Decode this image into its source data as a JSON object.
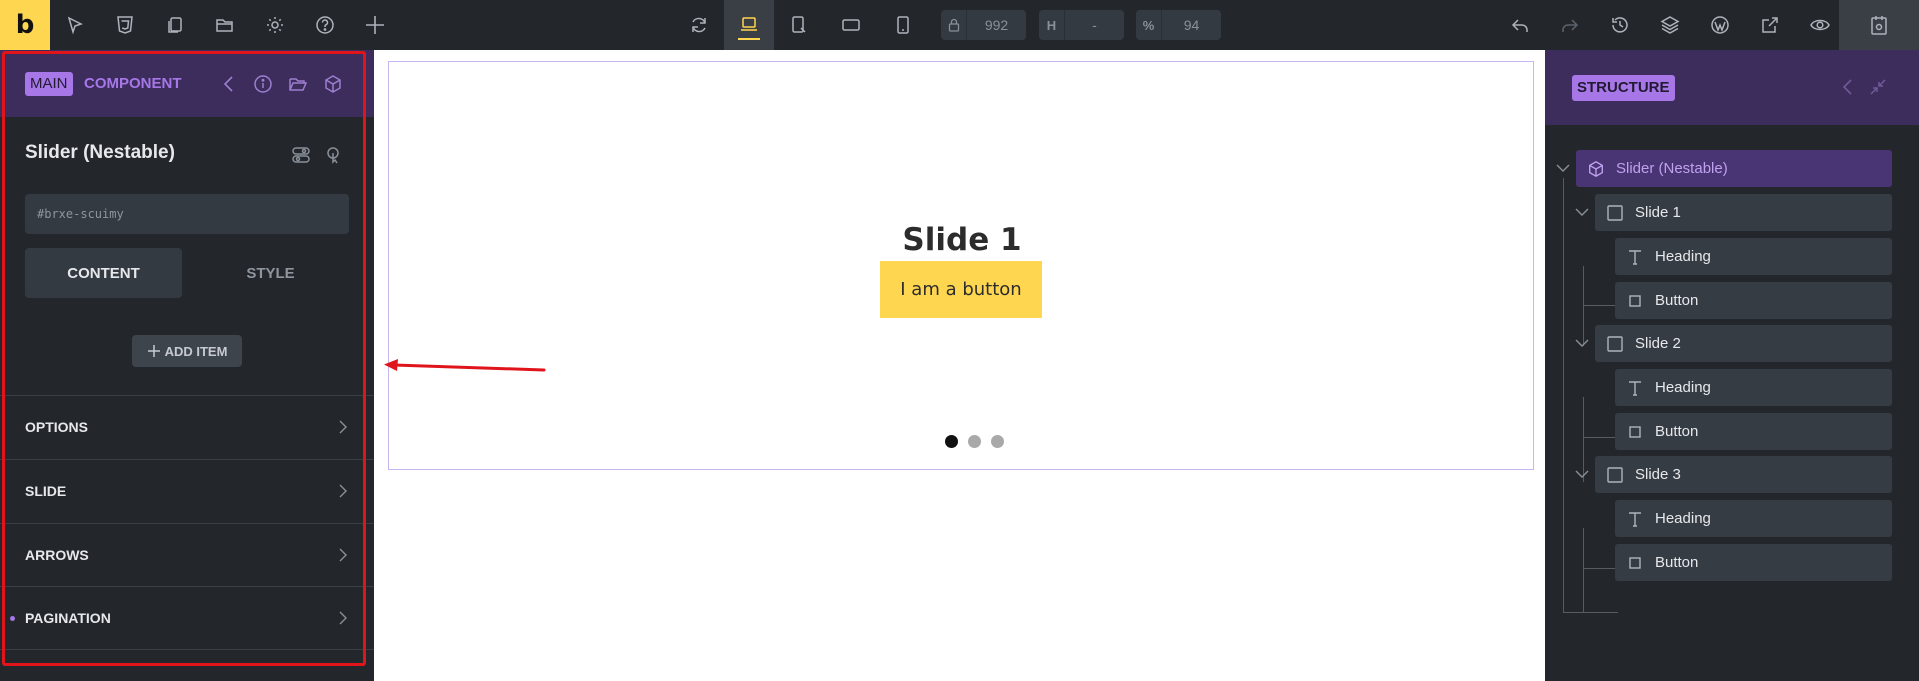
{
  "toolbar": {
    "logo": "b",
    "width": {
      "value": "992"
    },
    "height": {
      "prefix": "H",
      "value": "-"
    },
    "zoom": {
      "prefix": "%",
      "value": "94"
    }
  },
  "left_panel": {
    "tags": {
      "main": "MAIN",
      "component": "COMPONENT"
    },
    "element_title": "Slider (Nestable)",
    "element_id": "#brxe-scuimy",
    "tabs": {
      "content": "CONTENT",
      "style": "STYLE"
    },
    "add_item": "ADD ITEM",
    "sections": [
      {
        "label": "OPTIONS"
      },
      {
        "label": "SLIDE"
      },
      {
        "label": "ARROWS"
      },
      {
        "label": "PAGINATION"
      }
    ]
  },
  "canvas": {
    "slide_heading": "Slide 1",
    "slide_button": "I am a button",
    "pagination": {
      "total": 3,
      "active": 1
    }
  },
  "right_panel": {
    "title": "STRUCTURE",
    "tree": {
      "root": "Slider (Nestable)",
      "slides": [
        {
          "label": "Slide 1",
          "children": [
            "Heading",
            "Button"
          ]
        },
        {
          "label": "Slide 2",
          "children": [
            "Heading",
            "Button"
          ]
        },
        {
          "label": "Slide 3",
          "children": [
            "Heading",
            "Button"
          ]
        }
      ]
    }
  },
  "colors": {
    "toolbar_bg": "#23272c",
    "accent_yellow": "#ffd64f",
    "accent_purple": "#a777e8",
    "header_purple": "#3c2d5c",
    "annotation_red": "#e0151c"
  }
}
